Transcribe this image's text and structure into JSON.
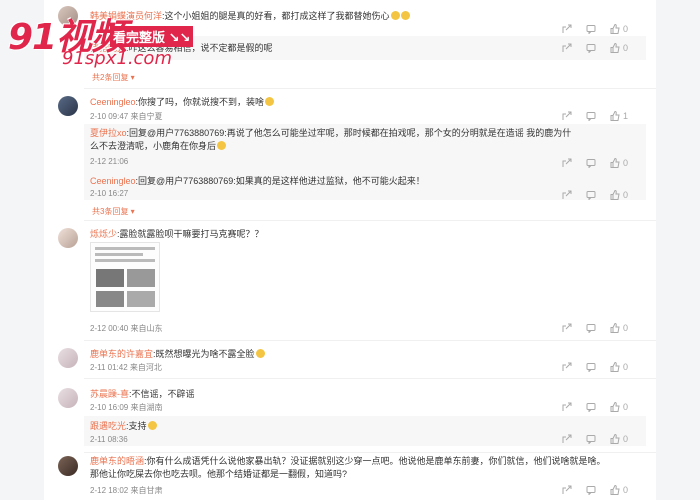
{
  "watermark": {
    "big": "91视频",
    "badge": "看完整版 ↘↘",
    "url": "91spx1.com"
  },
  "comments": [
    {
      "id": "c0",
      "author": "韩美娟蝶演员何洋",
      "text": ":这个小姐姐的腿是真的好看，都打成这样了我都替她伤心",
      "likes": "0",
      "reply": {
        "author": "猪猪吃光",
        "text": ":咋这么容易相信，说不定都是假的呢",
        "likes": "0"
      },
      "expand": "共2条回复"
    },
    {
      "id": "c1",
      "author": "Ceeningleo",
      "text": ":你搜了吗，你就说搜不到，装啥",
      "meta": "2-10 09:47 来自宁夏",
      "likes": "1",
      "replies": [
        {
          "author": "夏伊拉xo",
          "text": ":回复@用户7763880769:再说了他怎么可能坐过牢呢，那时候都在拍戏呢，那个女的分明就是在造谣 我的鹿为什么不去澄清呢，小鹿角在你身后",
          "meta": "2-12 21:06",
          "likes": "0"
        },
        {
          "author": "Ceeningleo",
          "text": ":回复@用户7763880769:如果真的是这样他进过监狱，他不可能火起来！",
          "meta": "2-10 16:27",
          "likes": "0"
        }
      ],
      "expand": "共3条回复"
    },
    {
      "id": "c2",
      "author": "烁烁少",
      "text": ":露脸就露脸呗干嘛要打马克赛呢？？",
      "meta": "2-12 00:40 来自山东",
      "likes": "0"
    },
    {
      "id": "c3",
      "author": "鹿单东的许嘉宜",
      "text": ":既然想曝光为啥不露全脸",
      "meta": "2-11 01:42 来自河北",
      "likes": "0"
    },
    {
      "id": "c4",
      "author": "苏晨躁-喜",
      "text": ":不信谣，不辟谣",
      "meta": "2-10 16:09 来自湖南",
      "likes": "0",
      "reply": {
        "author": "跟遇吃光",
        "text": ":支持",
        "meta": "2-11 08:36",
        "likes": "0"
      }
    },
    {
      "id": "c5",
      "author": "鹿单东的晤涵",
      "text": ":你有什么成语凭什么说他家暴出轨？没证据就别这少穿一点吧。他说他是鹿单东前妻，你们就信，他们说啥就是啥。那他让你吃屎去你也吃去呗。他那个结婚证都是一翻假，知道吗?",
      "meta": "2-12 18:02 来自甘肃",
      "likes": "0"
    }
  ],
  "icons": {
    "share": "share-icon",
    "comment": "comment-icon",
    "like": "like-icon"
  }
}
